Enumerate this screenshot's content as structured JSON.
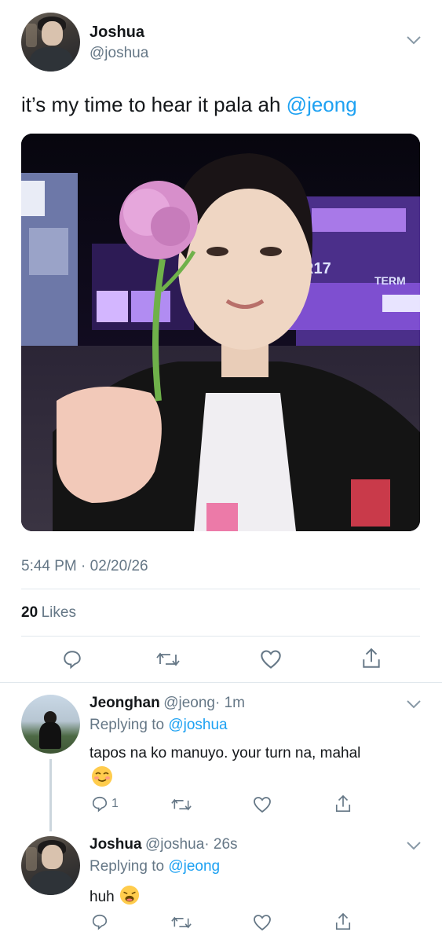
{
  "main_tweet": {
    "author_name": "Joshua",
    "author_handle": "@joshua",
    "text_before": "it’s my time to hear it pala ah ",
    "mention": "@jeong",
    "timestamp": "5:44 PM · 02/20/26",
    "likes_count": "20",
    "likes_label": "Likes",
    "media_signs": [
      "R17",
      "TERM"
    ]
  },
  "actions": {
    "reply_icon": "reply-icon",
    "retweet_icon": "retweet-icon",
    "like_icon": "heart-icon",
    "share_icon": "share-icon"
  },
  "replies": [
    {
      "author_name": "Jeonghan",
      "author_handle": "@jeong",
      "time": "· 1m",
      "replying_prefix": "Replying to ",
      "replying_to": "@joshua",
      "text": "tapos na ko manuyo. your turn na, mahal",
      "emoji": "smiling-blush-emoji",
      "reply_count": "1"
    },
    {
      "author_name": "Joshua",
      "author_handle": "@joshua",
      "time": "· 26s",
      "replying_prefix": "Replying to ",
      "replying_to": "@jeong",
      "text": "huh",
      "emoji": "weary-face-emoji"
    }
  ]
}
